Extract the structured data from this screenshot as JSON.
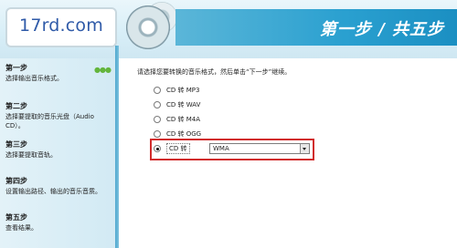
{
  "header": {
    "logo_text": "17rd.com",
    "step_title": "第一步 / 共五步"
  },
  "sidebar": {
    "steps": [
      {
        "title": "第一步",
        "desc": "选择输出音乐格式。",
        "active": true
      },
      {
        "title": "第二步",
        "desc": "选择要提取的音乐光盘（Audio CD）。"
      },
      {
        "title": "第三步",
        "desc": "选择要提取音轨。"
      },
      {
        "title": "第四步",
        "desc": "设置输出路径、输出的音乐音质。"
      },
      {
        "title": "第五步",
        "desc": "查看结果。"
      }
    ]
  },
  "main": {
    "prompt": "请选择您要转换的音乐格式，然后单击“下一步”继续。",
    "options": [
      {
        "label": "CD 转 MP3",
        "selected": false
      },
      {
        "label": "CD 转 WAV",
        "selected": false
      },
      {
        "label": "CD 转 M4A",
        "selected": false
      },
      {
        "label": "CD 转 OGG",
        "selected": false
      },
      {
        "label": "CD 转",
        "selected": true
      }
    ],
    "format_select": {
      "value": "WMA"
    }
  },
  "colors": {
    "accent": "#2aa0d0",
    "highlight_border": "#d12b2b",
    "logo_text": "#2f5aa8",
    "indicator_dots": "#63b53c"
  },
  "icons": {
    "disc": "cd-disc-icon",
    "dropdown": "chevron-down-icon",
    "progress": "three-dots-icon"
  }
}
